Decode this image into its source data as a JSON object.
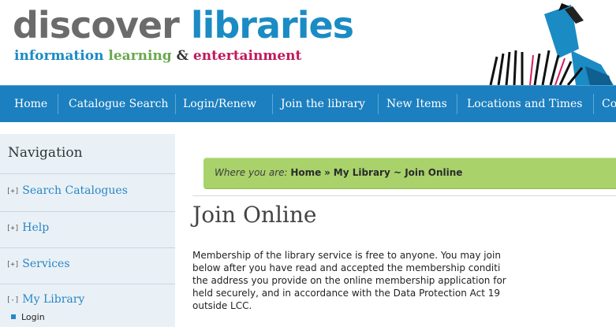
{
  "header": {
    "logo_word1": "discover",
    "logo_word2": "libraries",
    "tagline_1": "information",
    "tagline_2": "learning",
    "tagline_3": "&",
    "tagline_4": "entertainment"
  },
  "nav": {
    "items": [
      "Home",
      "Catalogue Search",
      "Login/Renew",
      "Join the library",
      "New Items",
      "Locations and Times",
      "Co"
    ]
  },
  "sidebar": {
    "title": "Navigation",
    "items": [
      {
        "toggle": "[+]",
        "label": "Search Catalogues"
      },
      {
        "toggle": "[+]",
        "label": "Help"
      },
      {
        "toggle": "[+]",
        "label": "Services"
      },
      {
        "toggle": "[-]",
        "label": "My Library"
      }
    ],
    "subitems": [
      "Login"
    ]
  },
  "breadcrumb": {
    "label": "Where you are:",
    "home": "Home",
    "sep": "»",
    "path": "My Library ~ Join Online"
  },
  "main": {
    "title": "Join Online",
    "paragraph_lines": [
      "Membership of the library service is free to anyone. You may join",
      "below after you have read and accepted the membership conditi",
      "the address you provide on the online membership application for",
      "held securely, and in accordance with the Data Protection Act 19",
      "outside LCC."
    ]
  },
  "colors": {
    "nav_bg": "#1c7fbf",
    "breadcrumb_bg": "#a9d26b",
    "link": "#2a86c7",
    "logo_blue": "#1b8bc4",
    "logo_grey": "#6b6b6b",
    "tagline_green": "#6aa84f",
    "tagline_pink": "#c2185b"
  }
}
